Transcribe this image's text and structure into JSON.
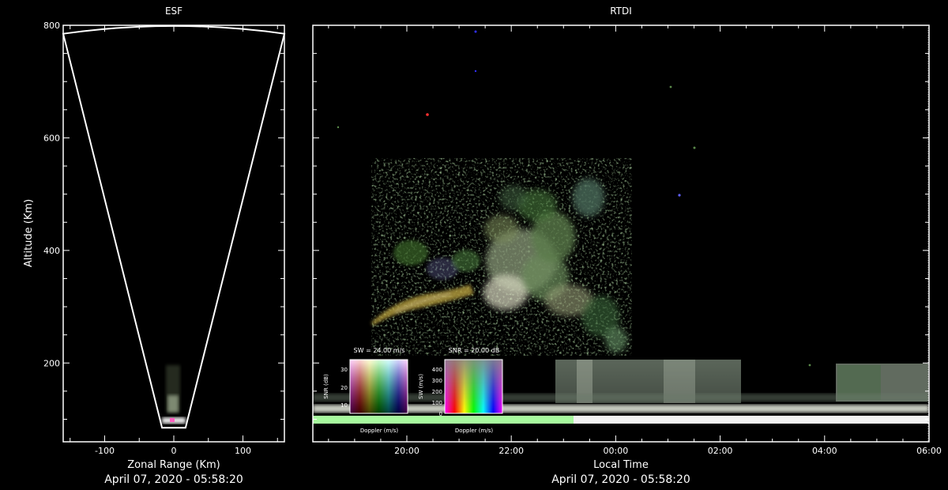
{
  "esf": {
    "title": "ESF",
    "xlabel": "Zonal Range (Km)",
    "ylabel": "Altitude (Km)",
    "timestamp": "April 07, 2020 - 05:58:20",
    "xticks": [
      -100,
      0,
      100
    ],
    "xtick_labels": [
      "-100",
      "0",
      "100"
    ],
    "yticks": [
      200,
      400,
      600,
      800
    ],
    "ytick_labels": [
      "200",
      "400",
      "600",
      "800"
    ]
  },
  "rtdi": {
    "title": "RTDI",
    "xlabel": "Local Time",
    "timestamp": "April 07, 2020 - 05:58:20",
    "xtick_labels": [
      "20:00",
      "22:00",
      "00:00",
      "02:00",
      "04:00",
      "06:00"
    ]
  },
  "legend_snr": {
    "title": "SW = 24.00 m/s",
    "ylabel": "SNR (dB)",
    "xlabel": "Doppler (m/s)",
    "ytick_labels": [
      "10",
      "20",
      "30"
    ]
  },
  "legend_sw": {
    "title": "SNR = 20.00 dB",
    "ylabel": "SW (m/s)",
    "xlabel": "Doppler (m/s)",
    "ytick_labels": [
      "0",
      "100",
      "200",
      "300",
      "400"
    ]
  },
  "colors": {
    "background": "#000000",
    "axes": "#ffffff",
    "echo_green": "#5a8a4a",
    "echo_bright": "#e8e8d8"
  },
  "chart_data": [
    {
      "type": "scatter",
      "panel": "ESF",
      "xlim": [
        -160,
        160
      ],
      "ylim": [
        60,
        800
      ],
      "fan_edges": [
        {
          "x": -160,
          "y": 785
        },
        {
          "x": -17,
          "y": 85
        },
        {
          "x": 17,
          "y": 85
        },
        {
          "x": 160,
          "y": 785
        }
      ],
      "echo_region": {
        "x_range": [
          -12,
          12
        ],
        "y_range": [
          80,
          190
        ]
      }
    },
    {
      "type": "heatmap",
      "panel": "RTDI",
      "x_unit": "local time (h)",
      "xlim": [
        18.2,
        30
      ],
      "ylim": [
        60,
        800
      ],
      "echo_regions": [
        {
          "time_range": [
            19.9,
            21.6
          ],
          "alt_range": [
            220,
            380
          ],
          "note": "plume lower branch"
        },
        {
          "time_range": [
            21.6,
            24.0
          ],
          "alt_range": [
            200,
            520
          ],
          "note": "main plume"
        },
        {
          "time_range": [
            22.5,
            26.5
          ],
          "alt_range": [
            100,
            150
          ],
          "note": "bottomside layer"
        },
        {
          "time_range": [
            28.2,
            30.0
          ],
          "alt_range": [
            100,
            150
          ],
          "note": "bottomside layer"
        },
        {
          "time_range": [
            18.2,
            30.0
          ],
          "alt_range": [
            75,
            95
          ],
          "note": "E/valley echoes"
        }
      ]
    }
  ]
}
